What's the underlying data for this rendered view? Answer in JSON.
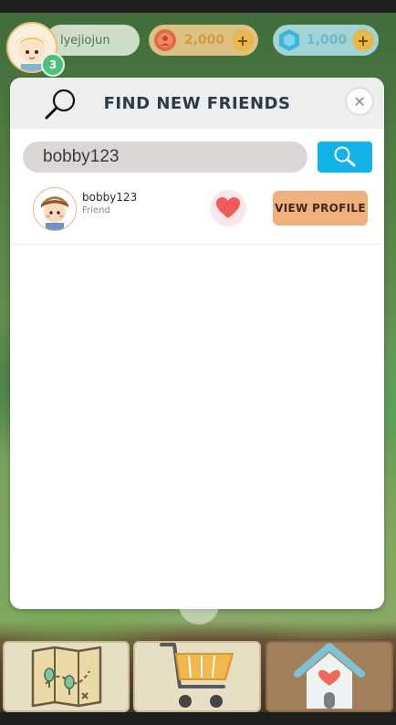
{
  "hud": {
    "username": "lyejiojun",
    "level": "3",
    "coins": "2,000",
    "gems": "1,000",
    "plus": "+"
  },
  "modal": {
    "title": "FIND NEW FRIENDS",
    "close": "✕",
    "search_value": "bobby123",
    "result": {
      "name": "bobby123",
      "status": "Friend",
      "view_profile": "VIEW PROFILE"
    }
  },
  "nav": {
    "items": [
      {
        "icon": "map-icon"
      },
      {
        "icon": "shopping-cart-icon"
      },
      {
        "icon": "home-icon"
      }
    ]
  },
  "colors": {
    "search_button": "#12b2ea",
    "view_profile_button": "#f0b07a",
    "heart": "#f25a5a",
    "level_badge": "#4fbf7f"
  }
}
